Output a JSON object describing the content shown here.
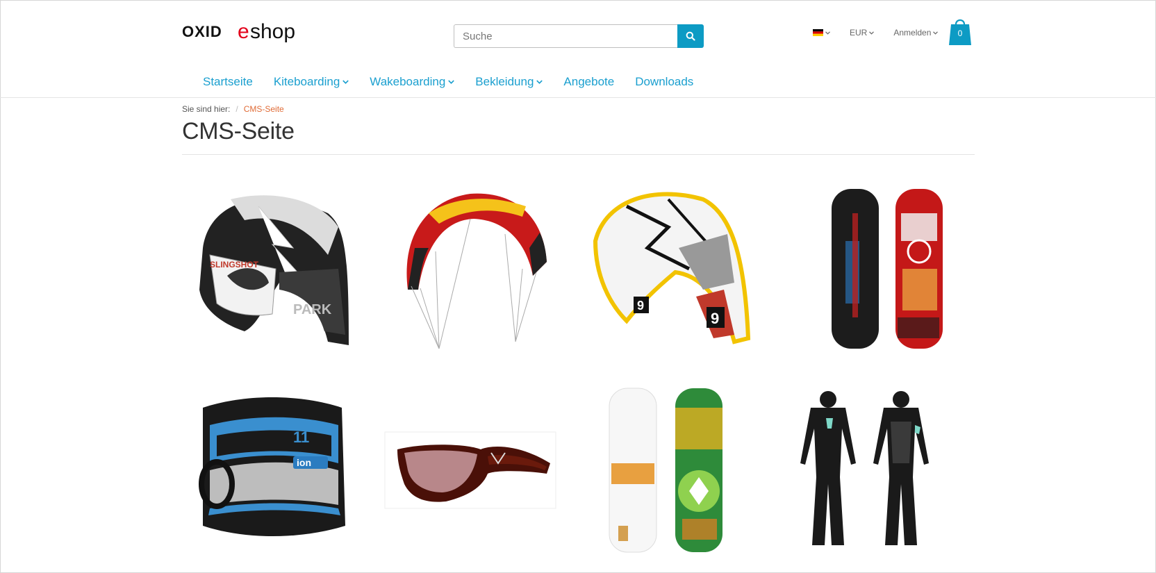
{
  "logo": {
    "part1": "OXID",
    "part2": "eshop"
  },
  "search": {
    "placeholder": "Suche",
    "value": ""
  },
  "top_links": {
    "language": "flag-de-icon",
    "currency": "EUR",
    "login": "Anmelden"
  },
  "cart": {
    "count": "0"
  },
  "nav": {
    "items": [
      {
        "label": "Startseite",
        "has_dropdown": false
      },
      {
        "label": "Kiteboarding",
        "has_dropdown": true
      },
      {
        "label": "Wakeboarding",
        "has_dropdown": true
      },
      {
        "label": "Bekleidung",
        "has_dropdown": true
      },
      {
        "label": "Angebote",
        "has_dropdown": false
      },
      {
        "label": "Downloads",
        "has_dropdown": false
      }
    ]
  },
  "breadcrumb": {
    "prefix": "Sie sind hier:",
    "current": "CMS-Seite"
  },
  "page": {
    "title": "CMS-Seite"
  },
  "products": [
    {
      "icon": "kite-park-image"
    },
    {
      "icon": "kite-red-image"
    },
    {
      "icon": "kite-yellow-image"
    },
    {
      "icon": "wakeboard-dark-image"
    },
    {
      "icon": "harness-image"
    },
    {
      "icon": "sunglasses-image"
    },
    {
      "icon": "wakeboard-white-green-image"
    },
    {
      "icon": "wetsuit-image"
    }
  ],
  "colors": {
    "accent": "#1a9fcf",
    "button": "#0d9bc4",
    "breadcrumb_active": "#e06b36",
    "logo_red": "#e3001b"
  }
}
